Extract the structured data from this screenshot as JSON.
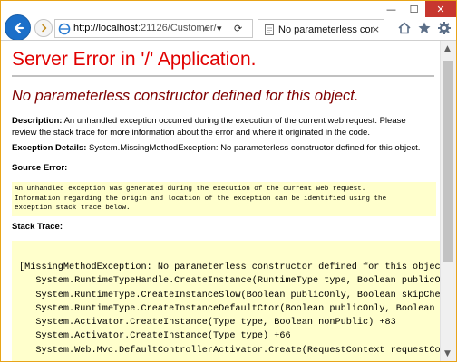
{
  "browser": {
    "url_host": "http://localhost",
    "url_rest": ":21126/Customer/",
    "address_controls": [
      "⌕",
      "▾",
      "⟳"
    ],
    "tab_title": "No parameterless con...",
    "tab_close": "×",
    "window_controls": {
      "minimize": "—",
      "maximize": "☐",
      "close": "✕"
    },
    "toolbar_icons": [
      "home-icon",
      "star-icon",
      "gear-icon"
    ]
  },
  "page": {
    "title": "Server Error in '/' Application.",
    "error_message": "No parameterless constructor defined for this object.",
    "description_label": "Description:",
    "description_text": "An unhandled exception occurred during the execution of the current web request. Please review the stack trace for more information about the error and where it originated in the code.",
    "exception_label": "Exception Details:",
    "exception_text": "System.MissingMethodException: No parameterless constructor defined for this object.",
    "source_error_label": "Source Error:",
    "source_error_text": "An unhandled exception was generated during the execution of the current web request.\nInformation regarding the origin and location of the exception can be identified using the\nexception stack trace below.",
    "stack_trace_label": "Stack Trace:",
    "stack_trace_lines": [
      "[MissingMethodException: No parameterless constructor defined for this object]",
      "   System.RuntimeTypeHandle.CreateInstance(RuntimeType type, Boolean publicOnly",
      "   System.RuntimeType.CreateInstanceSlow(Boolean publicOnly, Boolean skipChec",
      "   System.RuntimeType.CreateInstanceDefaultCtor(Boolean publicOnly, Boolean s",
      "   System.Activator.CreateInstance(Type type, Boolean nonPublic) +83",
      "   System.Activator.CreateInstance(Type type) +66",
      "   System.Web.Mvc.DefaultControllerActivator.Create(RequestContext requestCon"
    ]
  },
  "colors": {
    "title_red": "#e00000",
    "error_maroon": "#800000",
    "code_bg": "#ffffcc",
    "back_button_blue": "#1b6fc9",
    "window_border": "#e8a317"
  }
}
